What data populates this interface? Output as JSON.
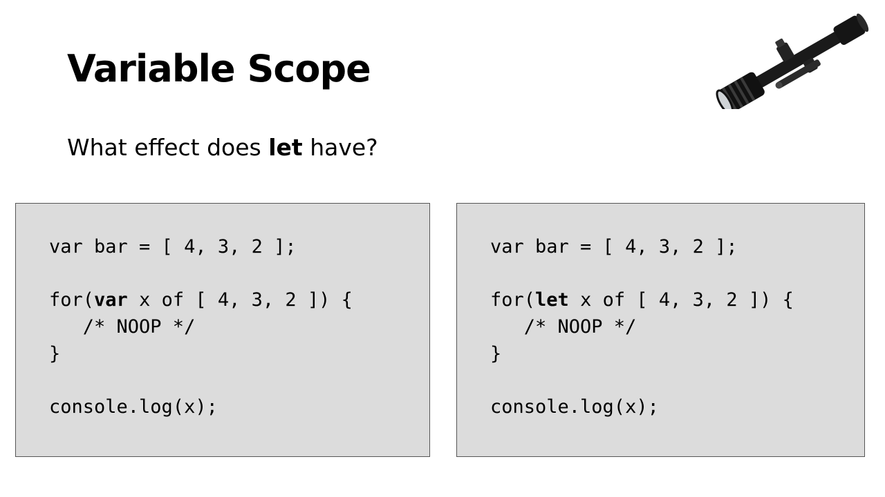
{
  "slide": {
    "title": "Variable Scope",
    "subtitle_prefix": "What effect does ",
    "subtitle_keyword": "let",
    "subtitle_suffix": " have?"
  },
  "image": {
    "icon": "rifle-scope-photo"
  },
  "colors": {
    "code_background": "#dcdcdc",
    "code_border": "#555555",
    "text": "#000000"
  },
  "code_left": {
    "line1": "var bar = [ 4, 3, 2 ];",
    "line3_prefix": "for(",
    "line3_keyword": "var",
    "line3_suffix": " x of [ 4, 3, 2 ]) {",
    "line4": "   /* NOOP */",
    "line5": "}",
    "line7": "console.log(x);"
  },
  "code_right": {
    "line1": "var bar = [ 4, 3, 2 ];",
    "line3_prefix": "for(",
    "line3_keyword": "let",
    "line3_suffix": " x of [ 4, 3, 2 ]) {",
    "line4": "   /* NOOP */",
    "line5": "}",
    "line7": "console.log(x);"
  }
}
